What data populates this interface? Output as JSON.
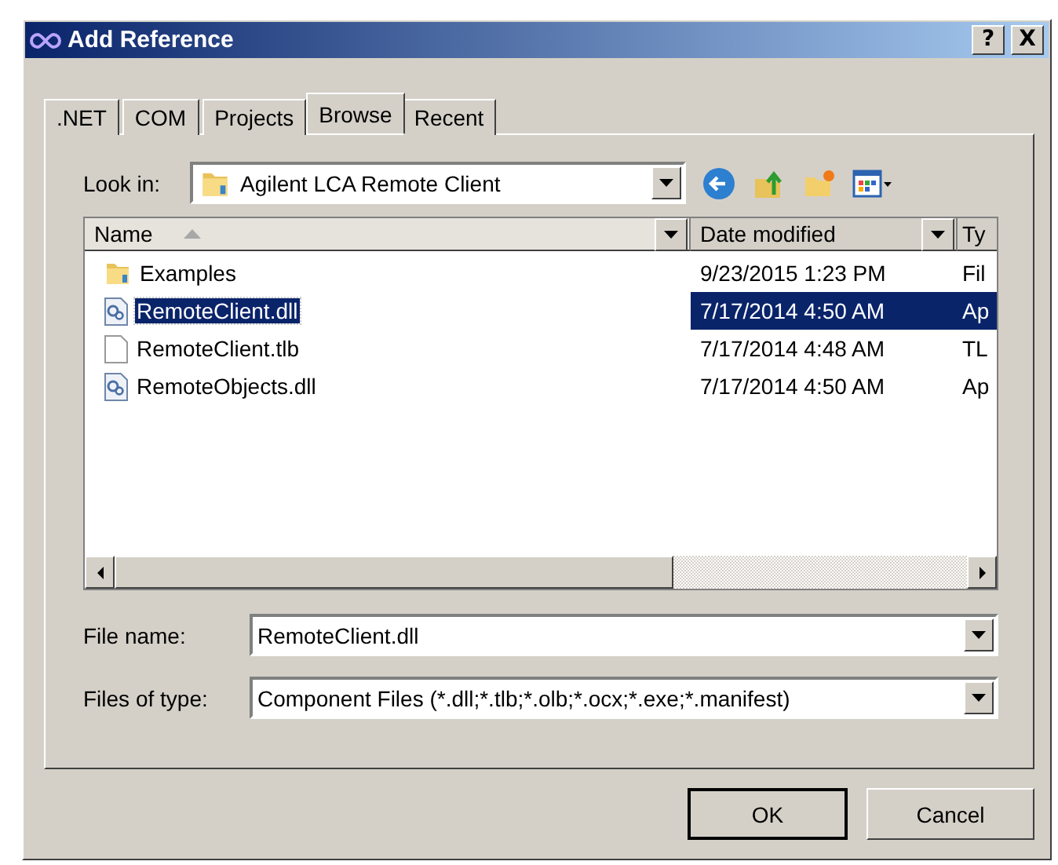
{
  "window": {
    "title": "Add Reference",
    "title_buttons": [
      "?",
      "X"
    ]
  },
  "tabs": [
    {
      "label": ".NET",
      "selected": false
    },
    {
      "label": "COM",
      "selected": false
    },
    {
      "label": "Projects",
      "selected": false
    },
    {
      "label": "Browse",
      "selected": true
    },
    {
      "label": "Recent",
      "selected": false
    }
  ],
  "look_in": {
    "label": "Look in:",
    "value": "Agilent LCA Remote Client"
  },
  "columns": [
    {
      "label": "Name",
      "sorted": true
    },
    {
      "label": "Date modified",
      "sorted": false
    },
    {
      "label": "Ty",
      "sorted": false
    }
  ],
  "rows": [
    {
      "kind": "folder",
      "name": "Examples",
      "date": "9/23/2015 1:23 PM",
      "type": "Fil",
      "selected": false
    },
    {
      "kind": "dll",
      "name": "RemoteClient.dll",
      "date": "7/17/2014 4:50 AM",
      "type": "Ap",
      "selected": true
    },
    {
      "kind": "file",
      "name": "RemoteClient.tlb",
      "date": "7/17/2014 4:48 AM",
      "type": "TL",
      "selected": false
    },
    {
      "kind": "dll",
      "name": "RemoteObjects.dll",
      "date": "7/17/2014 4:50 AM",
      "type": "Ap",
      "selected": false
    }
  ],
  "file_name": {
    "label": "File name:",
    "value": "RemoteClient.dll"
  },
  "file_type": {
    "label": "Files of type:",
    "value": "Component Files (*.dll;*.tlb;*.olb;*.ocx;*.exe;*.manifest)"
  },
  "buttons": [
    {
      "label": "OK",
      "default": true
    },
    {
      "label": "Cancel",
      "default": false
    }
  ]
}
